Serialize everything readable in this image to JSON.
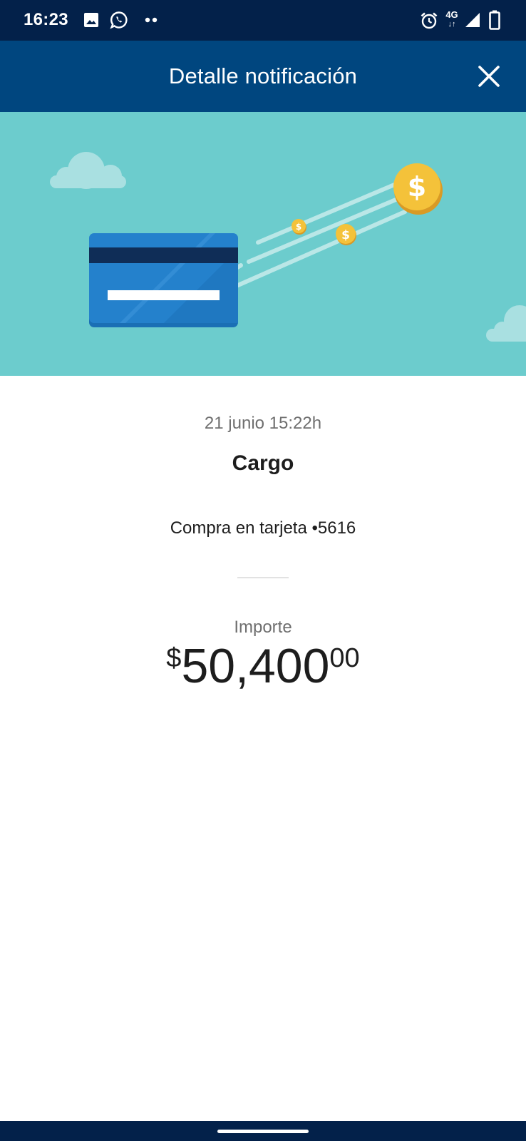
{
  "status_bar": {
    "time": "16:23",
    "network": "4G",
    "icons": [
      "image-icon",
      "whatsapp-icon",
      "more-dots-icon",
      "alarm-icon",
      "network-4g-icon",
      "signal-icon",
      "battery-icon"
    ]
  },
  "header": {
    "title": "Detalle notificación",
    "close_icon": "close-icon"
  },
  "hero": {
    "illustration": "credit-card-with-flying-coins",
    "coin_symbol": "$",
    "colors": {
      "background": "#6ccccd",
      "card": "#1f7bc6",
      "coin": "#f4c23a"
    }
  },
  "notification": {
    "date": "21 junio 15:22h",
    "title": "Cargo",
    "description": "Compra en tarjeta •5616",
    "amount_label": "Importe",
    "amount": {
      "currency": "$",
      "integer": "50,400",
      "cents": "00"
    }
  },
  "colors": {
    "header": "#00467f",
    "status_bar": "#03214a",
    "text_primary": "#1d1d1d",
    "text_secondary": "#6f6f6f"
  }
}
